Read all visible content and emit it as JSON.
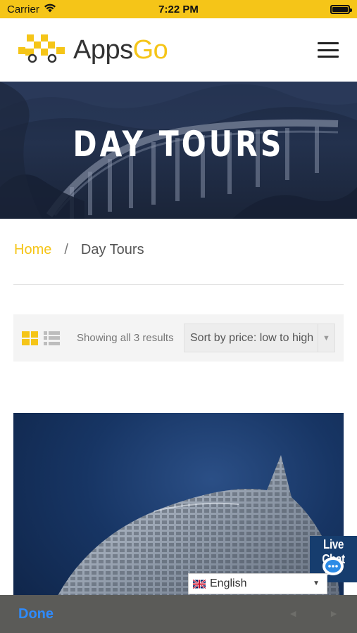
{
  "status_bar": {
    "carrier": "Carrier",
    "time": "7:22 PM"
  },
  "header": {
    "logo_main": "Apps",
    "logo_accent": "Go"
  },
  "hero": {
    "title": "DAY TOURS"
  },
  "breadcrumb": {
    "home": "Home",
    "separator": "/",
    "current": "Day Tours"
  },
  "toolbar": {
    "result_count": "Showing all 3 results",
    "sort_selected": "Sort by price: low to high"
  },
  "live_chat": {
    "label": "Live Chat"
  },
  "language": {
    "selected": "English"
  },
  "keyboard_accessory": {
    "done_label": "Done",
    "prev_arrow": "◄",
    "next_arrow": "►"
  },
  "colors": {
    "brand_yellow": "#f5c518",
    "chat_blue": "#163d6e",
    "done_blue": "#2e8bff"
  }
}
